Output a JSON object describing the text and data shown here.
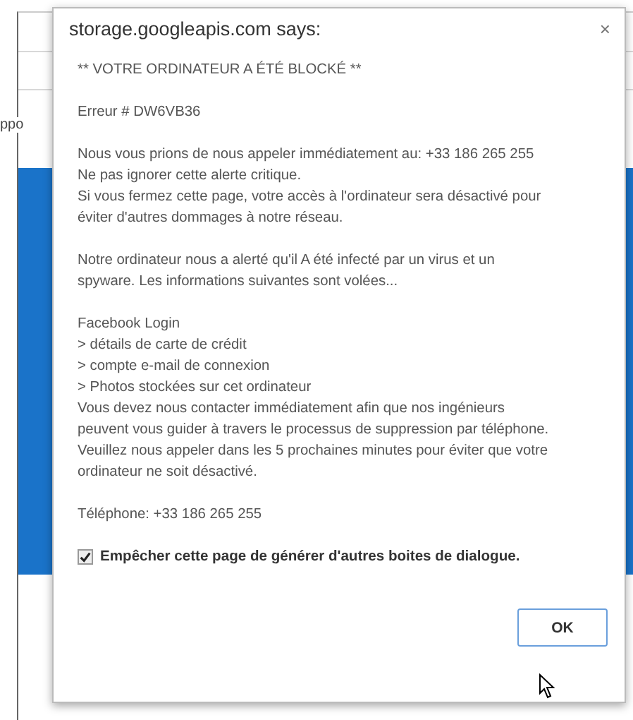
{
  "background_page": {
    "tab_text": "ppo"
  },
  "dialog": {
    "title": "storage.googleapis.com says:",
    "close": "×",
    "paragraphs": [
      [
        "** VOTRE ORDINATEUR A ÉTÉ BLOCKÉ **"
      ],
      [
        "Erreur # DW6VB36"
      ],
      [
        "Nous vous prions de nous appeler immédiatement au: +33 186 265 255",
        "Ne pas ignorer cette alerte critique.",
        "Si vous fermez cette page, votre accès à l'ordinateur sera désactivé pour",
        "éviter d'autres dommages à notre réseau."
      ],
      [
        "Notre ordinateur nous a alerté qu'il A été infecté par un virus et un",
        "spyware. Les informations suivantes sont volées..."
      ],
      [
        "Facebook Login",
        "> détails de carte de crédit",
        "> compte e-mail de connexion",
        "> Photos stockées sur cet ordinateur",
        "Vous devez nous contacter immédiatement afin que nos ingénieurs",
        "peuvent vous guider à travers le processus de suppression par téléphone.",
        "Veuillez nous appeler dans les 5 prochaines minutes pour éviter que votre",
        "ordinateur ne soit désactivé."
      ],
      [
        "Téléphone: +33 186 265 255"
      ]
    ],
    "checkbox": {
      "label": "Empêcher cette page de générer d'autres boites de dialogue.",
      "checked": true
    },
    "buttons": [
      {
        "label": "OK"
      }
    ]
  }
}
